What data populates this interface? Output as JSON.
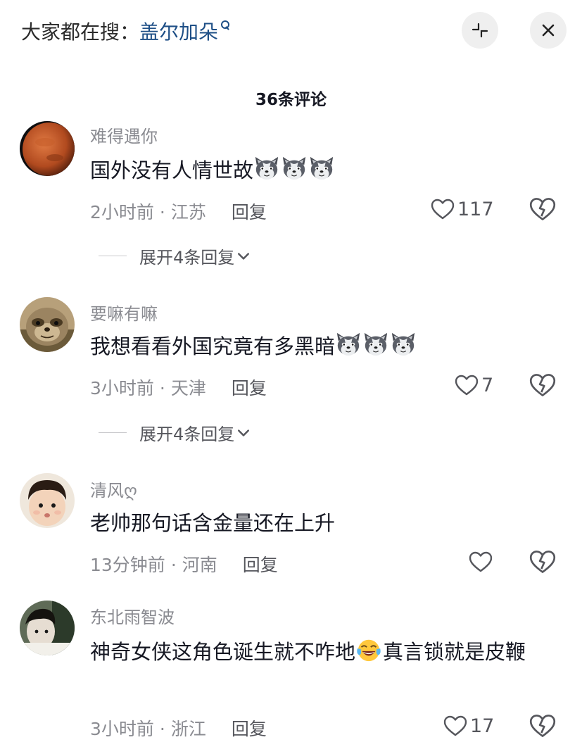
{
  "header": {
    "search_prefix": "大家都在搜：",
    "search_keyword": "盖尔加朵",
    "collapse_label": "collapse-icon",
    "close_label": "close-icon"
  },
  "comment_count": "36条评论",
  "comments": [
    {
      "username": "难得遇你",
      "text": "国外没有人情世故",
      "emoji": "wolf-emoji x3",
      "time": "2小时前",
      "location": "江苏",
      "reply_label": "回复",
      "likes": "117",
      "expand_label": "展开4条回复"
    },
    {
      "username": "要嘛有嘛",
      "text": "我想看看外国究竟有多黑暗",
      "emoji": "wolf-emoji x3",
      "time": "3小时前",
      "location": "天津",
      "reply_label": "回复",
      "likes": "7",
      "expand_label": "展开4条回复"
    },
    {
      "username": "清风ღ",
      "text": "老帅那句话含金量还在上升",
      "time": "13分钟前",
      "location": "河南",
      "reply_label": "回复",
      "likes": ""
    },
    {
      "username": "东北雨智波",
      "text_part1": "神奇女侠这角色诞生就不咋地",
      "text_part2": "真言锁就是皮鞭",
      "emoji": "laugh-cry-emoji",
      "time": "3小时前",
      "location": "浙江",
      "reply_label": "回复",
      "likes": "17"
    }
  ],
  "colors": {
    "keyword": "#1e4f86",
    "meta": "#8a8b91",
    "text": "#161823"
  }
}
